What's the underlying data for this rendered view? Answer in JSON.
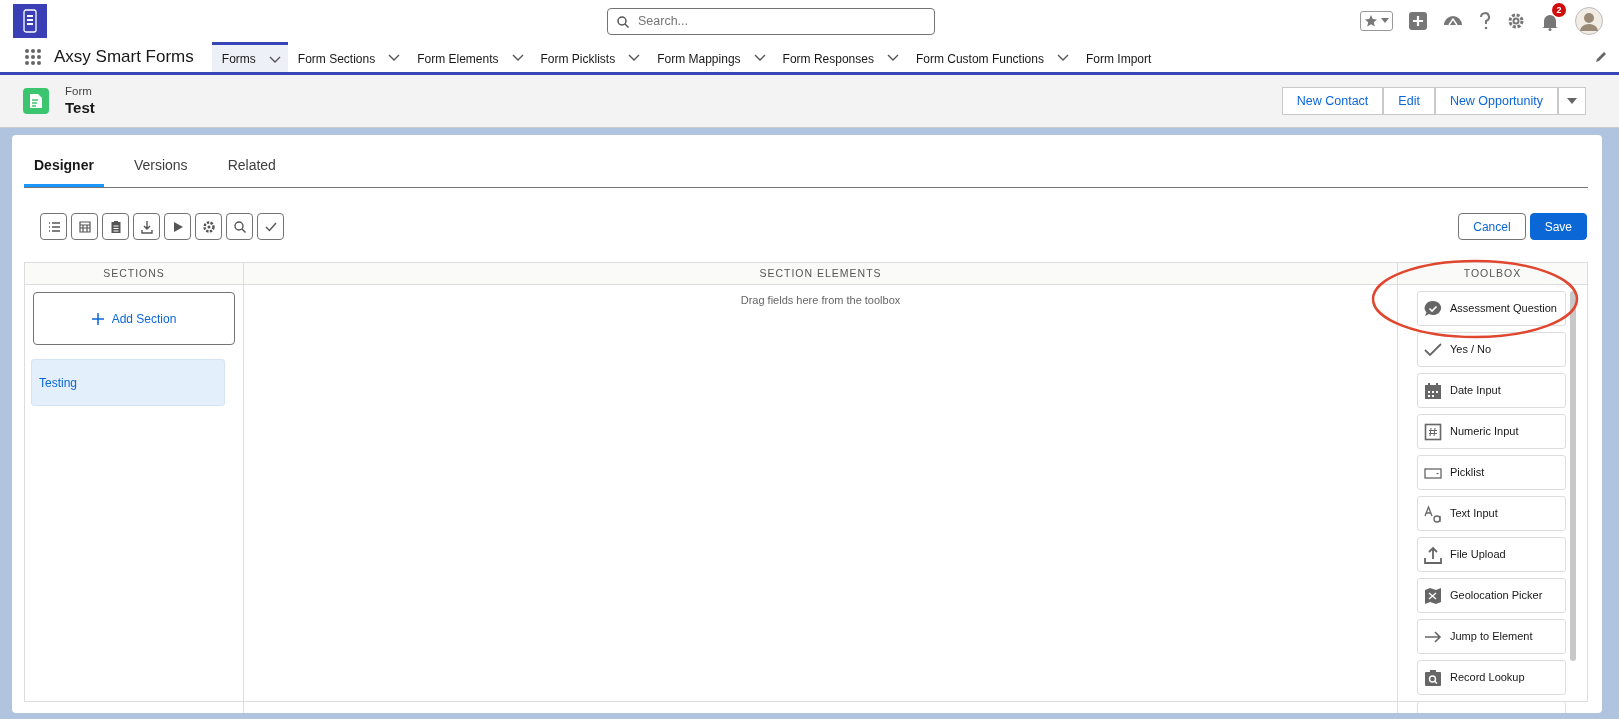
{
  "app": {
    "name": "Axsy Smart Forms"
  },
  "search": {
    "placeholder": "Search..."
  },
  "notifications": {
    "count": "2"
  },
  "nav_tabs": [
    {
      "label": "Forms",
      "selected": true,
      "dropdown": true
    },
    {
      "label": "Form Sections",
      "selected": false,
      "dropdown": true
    },
    {
      "label": "Form Elements",
      "selected": false,
      "dropdown": true
    },
    {
      "label": "Form Picklists",
      "selected": false,
      "dropdown": true
    },
    {
      "label": "Form Mappings",
      "selected": false,
      "dropdown": true
    },
    {
      "label": "Form Responses",
      "selected": false,
      "dropdown": true
    },
    {
      "label": "Form Custom Functions",
      "selected": false,
      "dropdown": true
    },
    {
      "label": "Form Import",
      "selected": false,
      "dropdown": false
    }
  ],
  "record": {
    "type": "Form",
    "title": "Test"
  },
  "actions": [
    "New Contact",
    "Edit",
    "New Opportunity"
  ],
  "tabs": [
    {
      "label": "Designer",
      "selected": true
    },
    {
      "label": "Versions",
      "selected": false
    },
    {
      "label": "Related",
      "selected": false
    }
  ],
  "buttons": {
    "cancel": "Cancel",
    "save": "Save"
  },
  "columns": [
    "SECTIONS",
    "SECTION ELEMENTS",
    "TOOLBOX"
  ],
  "add_section": "Add Section",
  "sections": [
    {
      "label": "Testing",
      "selected": true
    }
  ],
  "drop_hint": "Drag fields here from the toolbox",
  "toolbox": [
    {
      "label": "Assessment Question",
      "kind": "assessment",
      "circled": true
    },
    {
      "label": "Yes / No",
      "kind": "yesno",
      "circled": false
    },
    {
      "label": "Date Input",
      "kind": "date",
      "circled": false
    },
    {
      "label": "Numeric Input",
      "kind": "number",
      "circled": false
    },
    {
      "label": "Picklist",
      "kind": "picklist",
      "circled": false
    },
    {
      "label": "Text Input",
      "kind": "text",
      "circled": false
    },
    {
      "label": "File Upload",
      "kind": "upload",
      "circled": false
    },
    {
      "label": "Geolocation Picker",
      "kind": "geo",
      "circled": false
    },
    {
      "label": "Jump to Element",
      "kind": "jump",
      "circled": false
    },
    {
      "label": "Record Lookup",
      "kind": "lookup",
      "circled": false
    }
  ]
}
